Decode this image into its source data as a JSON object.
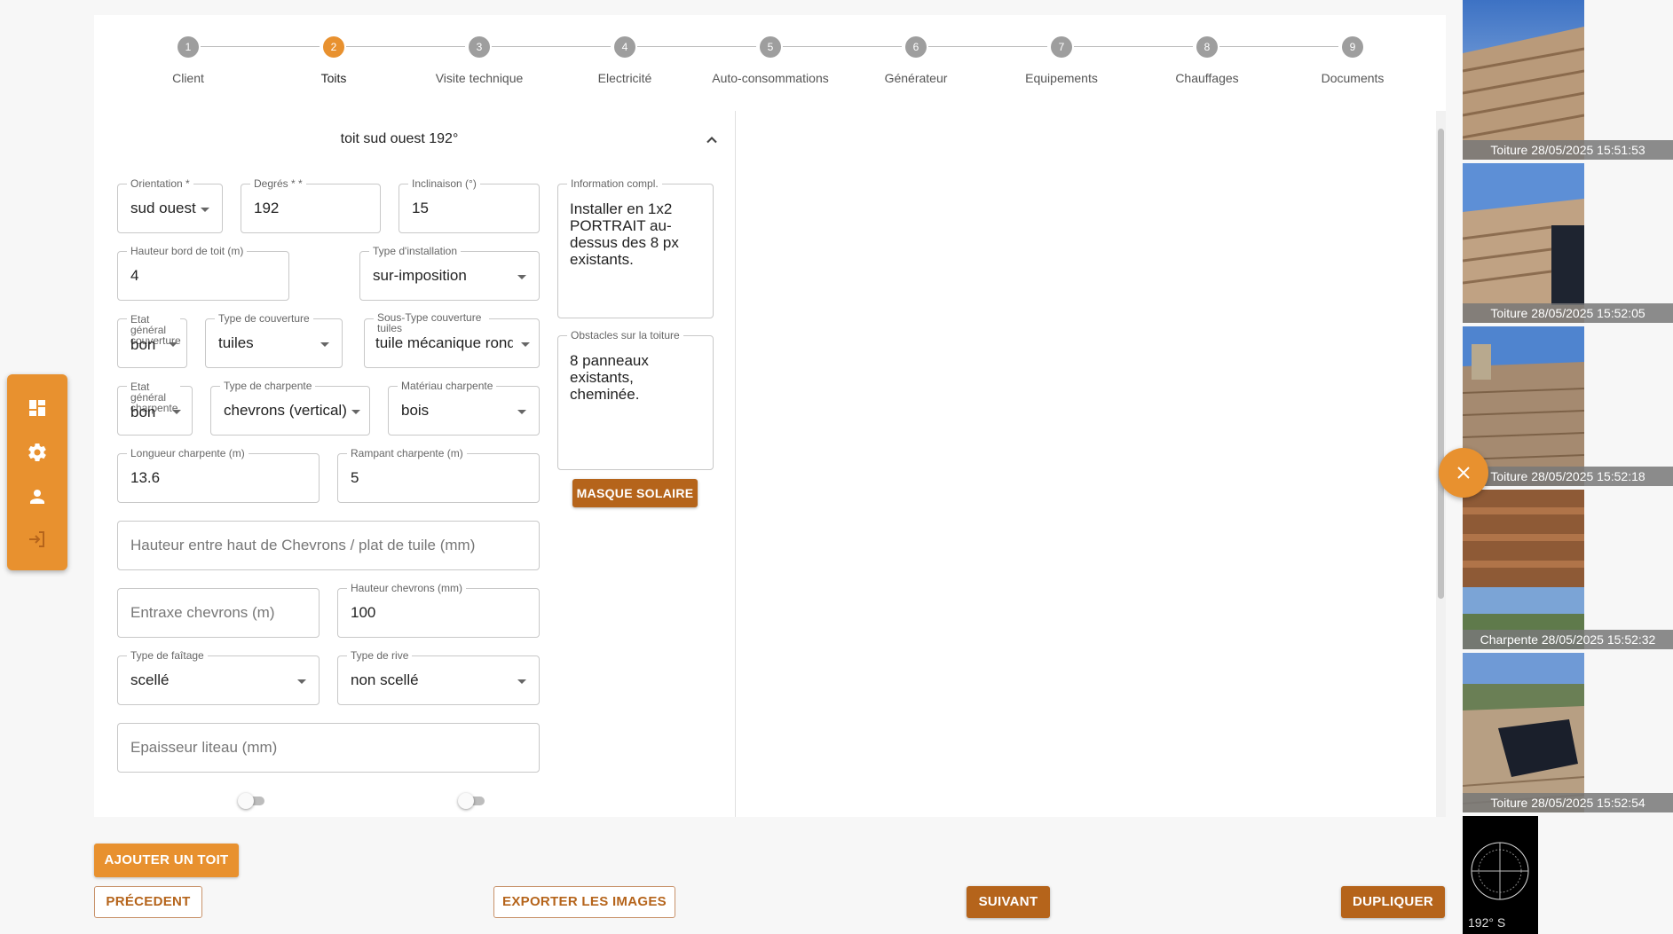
{
  "stepper": {
    "steps": [
      {
        "number": "1",
        "label": "Client"
      },
      {
        "number": "2",
        "label": "Toits"
      },
      {
        "number": "3",
        "label": "Visite technique"
      },
      {
        "number": "4",
        "label": "Electricité"
      },
      {
        "number": "5",
        "label": "Auto-consommations"
      },
      {
        "number": "6",
        "label": "Générateur"
      },
      {
        "number": "7",
        "label": "Equipements"
      },
      {
        "number": "8",
        "label": "Chauffages"
      },
      {
        "number": "9",
        "label": "Documents"
      }
    ],
    "active_index": 1
  },
  "roof": {
    "title": "toit sud ouest 192°",
    "orientation": {
      "label": "Orientation *",
      "value": "sud ouest"
    },
    "degres": {
      "label": "Degrés * *",
      "value": "192"
    },
    "inclinaison": {
      "label": "Inclinaison (°)",
      "value": "15"
    },
    "info_compl": {
      "label": "Information compl.",
      "value": "Installer en 1x2 PORTRAIT au-dessus des 8 px existants."
    },
    "hauteur_bord": {
      "label": "Hauteur bord de toit (m)",
      "value": "4"
    },
    "type_installation": {
      "label": "Type d'installation",
      "value": "sur-imposition"
    },
    "obstacles": {
      "label": "Obstacles sur la toiture",
      "value": "8 panneaux existants, cheminée."
    },
    "etat_couverture": {
      "label": "Etat général couverture",
      "value": "bon"
    },
    "type_couverture": {
      "label": "Type de couverture",
      "value": "tuiles"
    },
    "sous_type_couverture": {
      "label": "Sous-Type couverture tuiles",
      "value": "tuile mécanique rond"
    },
    "etat_charpente": {
      "label": "Etat général charpente",
      "value": "bon"
    },
    "type_charpente": {
      "label": "Type de charpente",
      "value": "chevrons (vertical)"
    },
    "materiau_charpente": {
      "label": "Matériau charpente",
      "value": "bois"
    },
    "longueur_charpente": {
      "label": "Longueur charpente (m)",
      "value": "13.6"
    },
    "rampant_charpente": {
      "label": "Rampant charpente (m)",
      "value": "5"
    },
    "hauteur_chevrons_plat": {
      "placeholder": "Hauteur entre haut de Chevrons / plat de tuile (mm)"
    },
    "entraxe_chevrons": {
      "placeholder": "Entraxe chevrons (m)"
    },
    "hauteur_chevrons": {
      "label": "Hauteur chevrons (mm)",
      "value": "100"
    },
    "type_faitage": {
      "label": "Type de faîtage",
      "value": "scellé"
    },
    "type_rive": {
      "label": "Type de rive",
      "value": "non scellé"
    },
    "epaisseur_liteau": {
      "placeholder": "Epaisseur liteau (mm)"
    },
    "masque_solaire_label": "MASQUE SOLAIRE"
  },
  "actions": {
    "ajouter_toit": "AJOUTER UN TOIT",
    "precedent": "PRÉCEDENT",
    "exporter_images": "EXPORTER LES IMAGES",
    "suivant": "SUIVANT",
    "dupliquer": "DUPLIQUER"
  },
  "photos": [
    {
      "caption": "Toiture 28/05/2025 15:51:53"
    },
    {
      "caption": "Toiture 28/05/2025 15:52:05"
    },
    {
      "caption": "Toiture 28/05/2025 15:52:18"
    },
    {
      "caption": "Charpente 28/05/2025 15:52:32"
    },
    {
      "caption": "Toiture 28/05/2025 15:52:54"
    },
    {
      "caption": "",
      "compass_text": "192° S"
    }
  ],
  "colors": {
    "accent": "#e8912f",
    "accent_dark": "#b5641b",
    "inactive_step": "#9e9e9e"
  }
}
